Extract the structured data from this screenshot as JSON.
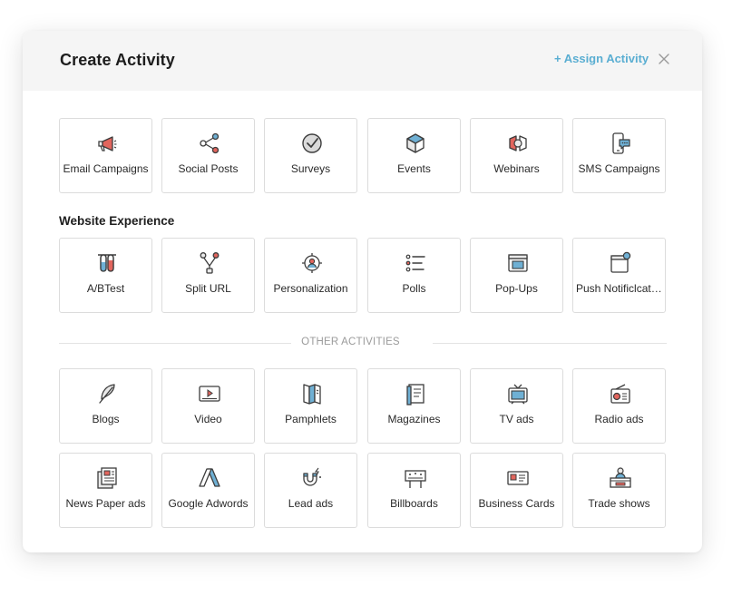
{
  "header": {
    "title": "Create Activity",
    "assign_label": "+ Assign Activity"
  },
  "campaigns": [
    {
      "label": "Email Campaigns",
      "icon": "megaphone-icon"
    },
    {
      "label": "Social Posts",
      "icon": "share-icon"
    },
    {
      "label": "Surveys",
      "icon": "checkmark-circle-icon"
    },
    {
      "label": "Events",
      "icon": "cube-icon"
    },
    {
      "label": "Webinars",
      "icon": "webinar-icon"
    },
    {
      "label": "SMS Campaigns",
      "icon": "mobile-chat-icon"
    }
  ],
  "website_experience": {
    "title": "Website Experience",
    "items": [
      {
        "label": "A/BTest",
        "icon": "test-tubes-icon"
      },
      {
        "label": "Split URL",
        "icon": "split-icon"
      },
      {
        "label": "Personalization",
        "icon": "target-user-icon"
      },
      {
        "label": "Polls",
        "icon": "list-icon"
      },
      {
        "label": "Pop-Ups",
        "icon": "popup-window-icon"
      },
      {
        "label": "Push Notificlcations",
        "icon": "push-notification-icon"
      }
    ]
  },
  "other_activities": {
    "title": "OTHER ACTIVITIES",
    "items": [
      {
        "label": "Blogs",
        "icon": "feather-icon"
      },
      {
        "label": "Video",
        "icon": "video-player-icon"
      },
      {
        "label": "Pamphlets",
        "icon": "pamphlet-icon"
      },
      {
        "label": "Magazines",
        "icon": "magazine-icon"
      },
      {
        "label": "TV ads",
        "icon": "tv-icon"
      },
      {
        "label": "Radio ads",
        "icon": "radio-icon"
      },
      {
        "label": "News Paper ads",
        "icon": "newspaper-icon"
      },
      {
        "label": "Google Adwords",
        "icon": "google-adwords-icon"
      },
      {
        "label": "Lead ads",
        "icon": "magnet-icon"
      },
      {
        "label": "Billboards",
        "icon": "billboard-icon"
      },
      {
        "label": "Business Cards",
        "icon": "business-card-icon"
      },
      {
        "label": "Trade shows",
        "icon": "trade-show-icon"
      }
    ]
  },
  "colors": {
    "accent": "#5aaed2",
    "icon_red": "#e2655d",
    "icon_blue": "#6fb0d4",
    "icon_outline": "#3c3c3c"
  }
}
